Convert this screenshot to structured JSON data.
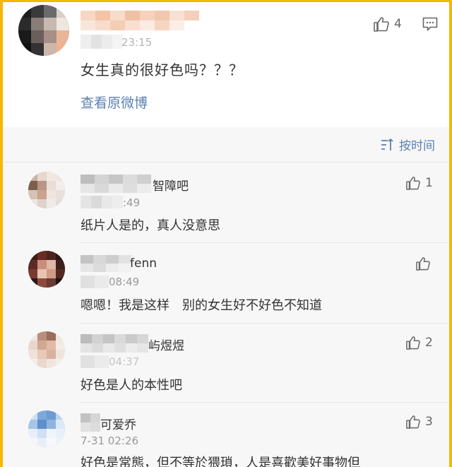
{
  "post": {
    "name_tail": "",
    "time_tail": "23:15",
    "content": "女生真的很好色吗？？？",
    "like_count": "4",
    "view_original": "查看原微博"
  },
  "sort": {
    "label": "按时间"
  },
  "comments": [
    {
      "name_tail": "智障吧",
      "time_tail": ":49",
      "content": "纸片人是的，真人没意思",
      "like_count": "1"
    },
    {
      "name_tail": "fenn",
      "time_tail": "08:49",
      "content": "嗯嗯！我是这样　别的女生好不好色不知道",
      "like_count": ""
    },
    {
      "name_tail": "屿煜煜",
      "time_tail": "04:37",
      "content": "好色是人的本性吧",
      "like_count": "2"
    },
    {
      "name_tail": "可爱乔",
      "time_tail": "7-31 02:26",
      "content": "好色是常態，但不等於猥瑣，人是喜歡美好事物但",
      "like_count": "3"
    }
  ],
  "colors": {
    "frame": "#f5b800",
    "link": "#5b80b2",
    "text": "#333333",
    "meta": "#999999"
  },
  "icons": [
    "thumbs-up-icon",
    "comment-icon",
    "sort-icon"
  ]
}
